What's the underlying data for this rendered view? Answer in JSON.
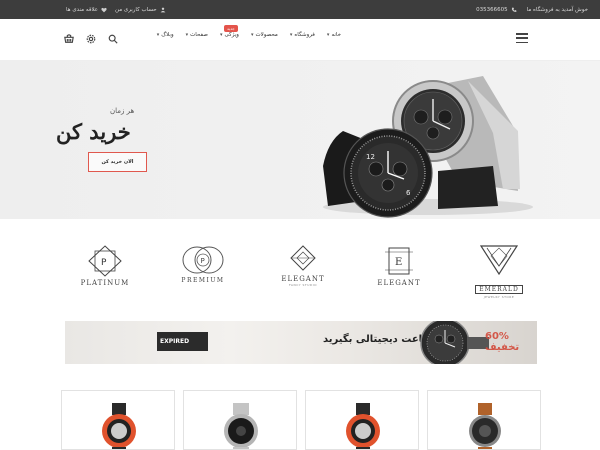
{
  "topbar": {
    "welcome": "خوش آمدید به فروشگاه ما",
    "phone": "035366605",
    "account": "حساب کاربری من",
    "wishlist": "علاقه مندی ها"
  },
  "nav": {
    "menu": [
      {
        "label": "خانه",
        "has_dropdown": true
      },
      {
        "label": "فروشگاه",
        "has_dropdown": true
      },
      {
        "label": "محصولات",
        "has_dropdown": true
      },
      {
        "label": "ویژگی",
        "has_dropdown": true,
        "badge": "جدید"
      },
      {
        "label": "صفحات",
        "has_dropdown": true
      },
      {
        "label": "وبلاگ",
        "has_dropdown": true
      }
    ],
    "icons": [
      "menu-icon",
      "search-icon",
      "settings-icon",
      "cart-icon"
    ]
  },
  "hero": {
    "subtitle": "هر زمان",
    "title": "خرید کن",
    "cta": "الان خرید کن"
  },
  "brands": [
    {
      "name": "EMERALD",
      "tagline": "JEWELRY STORE"
    },
    {
      "name": "ELEGANT",
      "tagline": ""
    },
    {
      "name": "ELEGANT",
      "tagline": "FANCY STUDIO"
    },
    {
      "name": "PREMIUM",
      "tagline": ""
    },
    {
      "name": "PLATINUM",
      "tagline": ""
    }
  ],
  "banner": {
    "badge": "EXPIRED",
    "text": "ساعت دیجیتالی بگیرید",
    "overlay": "60% تخفیف"
  },
  "products": [
    {
      "name": "watch-product-1"
    },
    {
      "name": "watch-product-2"
    },
    {
      "name": "watch-product-3"
    },
    {
      "name": "watch-product-4"
    }
  ],
  "colors": {
    "topbar_bg": "#3d3d3d",
    "accent": "#e0584e",
    "text_dark": "#222222"
  }
}
